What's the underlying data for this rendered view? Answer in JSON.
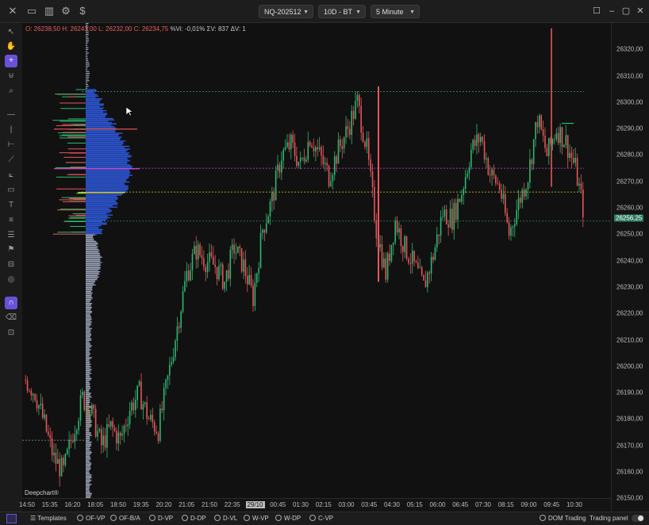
{
  "topbar": {
    "symbol": "NQ-202512",
    "timeframe_range": "10D - BT",
    "interval": "5 Minute"
  },
  "ohlc": {
    "o": "O: 26238,50",
    "h": "H: 26243,00",
    "l": "L: 26232,00",
    "c": "C: 26234,75",
    "vi": "%Vi: -0,01%",
    "sv": "ΣV: 837",
    "dv": "ΔV: 1"
  },
  "watermark": "Deepchart®",
  "price_axis": {
    "ticks": [
      "26320,00",
      "26310,00",
      "26300,00",
      "26290,00",
      "26280,00",
      "26270,00",
      "26260,00",
      "26250,00",
      "26240,00",
      "26230,00",
      "26220,00",
      "26210,00",
      "26200,00",
      "26190,00",
      "26180,00",
      "26170,00",
      "26160,00",
      "26150,00"
    ],
    "last_price": "26256,25"
  },
  "time_axis": {
    "ticks": [
      "14:50",
      "15:35",
      "16:20",
      "18:05",
      "18:50",
      "19:35",
      "20:20",
      "21:05",
      "21:50",
      "22:35",
      "29/10",
      "00:45",
      "01:30",
      "02:15",
      "03:00",
      "03:45",
      "04:30",
      "05:15",
      "06:00",
      "06:45",
      "07:30",
      "08:15",
      "09:00",
      "09:45",
      "10:30"
    ],
    "highlight": "29/10"
  },
  "bottom_bar": {
    "templates": "Templates",
    "options": [
      "OF-VP",
      "OF-B/A",
      "D-VP",
      "D-DP",
      "D-VL",
      "W-VP",
      "W-DP",
      "C-VP"
    ],
    "dom_trading": "DOM Trading",
    "trading_panel": "Trading panel"
  },
  "icons": {
    "close": "close-icon",
    "layout": "layout-icon",
    "chart": "bar-chart-icon",
    "settings": "gear-icon",
    "currency": "dollar-icon"
  },
  "colors": {
    "bull": "#2fb872",
    "bear": "#e8555a",
    "profile_blue": "#2d57d6",
    "profile_gray": "#9aa4b8",
    "poc_line": "#d6d62a",
    "vah_line": "#d14ad6",
    "range_line": "#2e8f6d",
    "accent": "#6a52d8"
  },
  "chart_data": {
    "type": "candlestick",
    "title": "",
    "xlabel": "",
    "ylabel": "",
    "ylim": [
      26145,
      26330
    ],
    "x": [
      "14:50",
      "15:35",
      "16:20",
      "18:05",
      "18:50",
      "19:35",
      "20:20",
      "21:05",
      "21:50",
      "22:35",
      "29/10",
      "00:45",
      "01:30",
      "02:15",
      "03:00",
      "03:45",
      "04:30",
      "05:15",
      "06:00",
      "06:45",
      "07:30",
      "08:15",
      "09:00",
      "09:45",
      "10:30"
    ],
    "close_path": [
      26195,
      26190,
      26178,
      26165,
      26160,
      26175,
      26188,
      26182,
      26170,
      26177,
      26172,
      26184,
      26190,
      26180,
      26176,
      26195,
      26215,
      26235,
      26244,
      26240,
      26238,
      26232,
      26245,
      26238,
      26226,
      26252,
      26263,
      26280,
      26284,
      26276,
      26287,
      26280,
      26272,
      26282,
      26290,
      26300,
      26282,
      26252,
      26235,
      26255,
      26245,
      26238,
      26230,
      26242,
      26258,
      26256,
      26266,
      26282,
      26287,
      26273,
      26268,
      26250,
      26262,
      26272,
      26294,
      26280,
      26290,
      26285,
      26275,
      26256
    ],
    "levels": {
      "upper_range": 26304,
      "poc": 26266,
      "value_high": 26275,
      "lower_range": 26255,
      "last": 26256.25
    }
  }
}
